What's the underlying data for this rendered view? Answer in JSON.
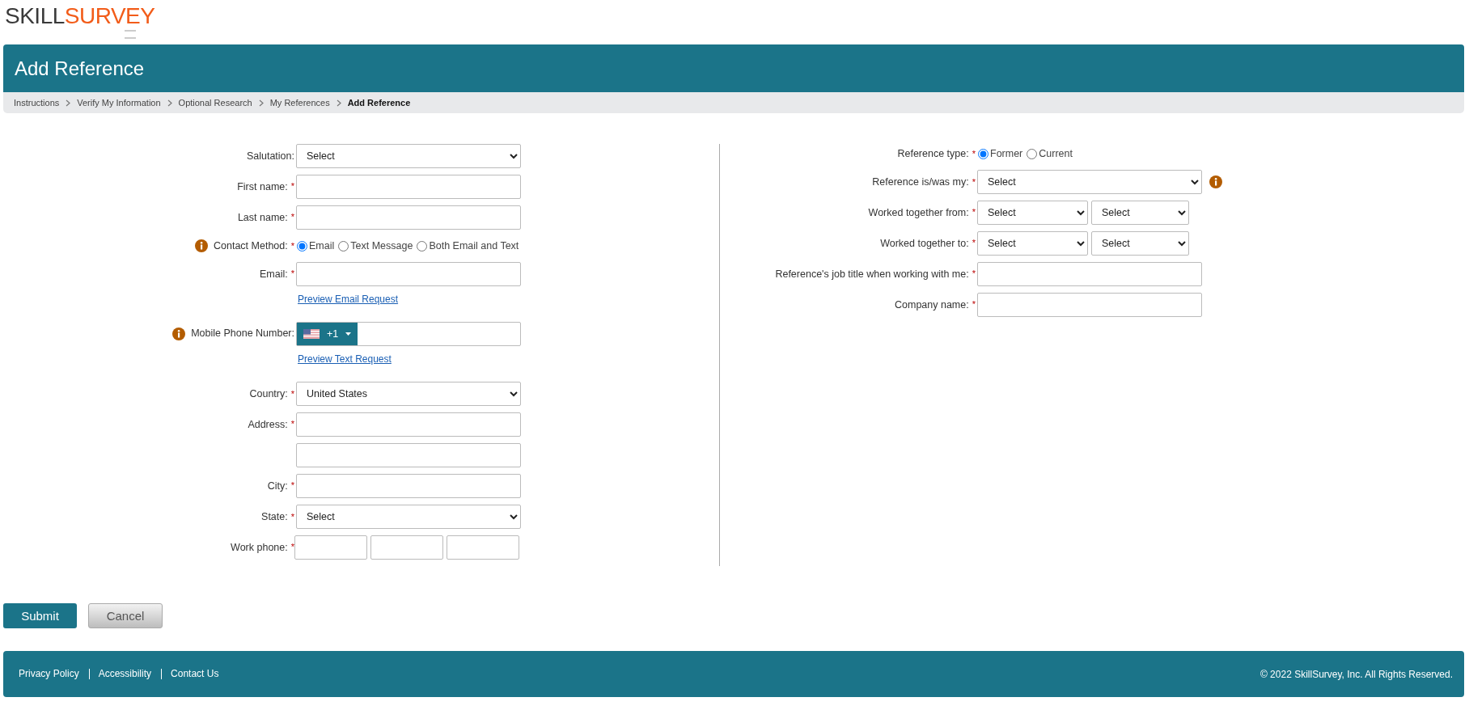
{
  "logo": {
    "first": "SKILL",
    "second": "SURVEY"
  },
  "header": {
    "title": "Add Reference"
  },
  "breadcrumb": [
    {
      "label": "Instructions",
      "current": false
    },
    {
      "label": "Verify My Information",
      "current": false
    },
    {
      "label": "Optional Research",
      "current": false
    },
    {
      "label": "My References",
      "current": false
    },
    {
      "label": "Add Reference",
      "current": true
    }
  ],
  "form": {
    "columns": [
      {
        "fields": [
          {
            "kind": "select",
            "label": "Salutation:",
            "value": "Select",
            "info": false
          },
          {
            "kind": "text",
            "label": "First name:",
            "required": "*",
            "info": false
          },
          {
            "kind": "text",
            "label": "Last name:",
            "required": "*",
            "info": false
          },
          {
            "kind": "radio",
            "label": "Contact Method:",
            "required": "*",
            "info": true,
            "options": [
              {
                "label": "Email",
                "selected": true
              },
              {
                "label": "Text Message",
                "selected": false
              },
              {
                "label": "Both Email and Text",
                "selected": false
              }
            ]
          },
          {
            "kind": "text",
            "label": "Email:",
            "required": "*",
            "info": false
          },
          {
            "kind": "link",
            "text": "Preview Email Request",
            "info": false
          },
          {
            "kind": "phone",
            "label": "Mobile Phone Number:",
            "code": "+1",
            "info": true
          },
          {
            "kind": "link",
            "text": "Preview Text Request",
            "info": false
          },
          {
            "kind": "select",
            "label": "Country:",
            "required": "*",
            "value": "United States",
            "info": false
          },
          {
            "kind": "text",
            "label": "Address:",
            "required": "*",
            "info": false
          },
          {
            "kind": "text",
            "info": false
          },
          {
            "kind": "text",
            "label": "City:",
            "required": "*",
            "info": false
          },
          {
            "kind": "select",
            "label": "State:",
            "required": "*",
            "value": "Select",
            "info": false
          },
          {
            "kind": "phone_parts",
            "label": "Work phone:",
            "required": "*",
            "info": false
          }
        ]
      },
      {
        "fields": [
          {
            "kind": "radio",
            "label": "Reference type:",
            "required": "*",
            "info": false,
            "options": [
              {
                "label": "Former",
                "selected": true
              },
              {
                "label": "Current",
                "selected": false
              }
            ]
          },
          {
            "kind": "select",
            "label": "Reference is/was my:",
            "required": "*",
            "value": "Select",
            "info": true
          },
          {
            "kind": "select_pair",
            "label": "Worked together from:",
            "required": "*",
            "values": [
              "Select",
              "Select"
            ],
            "info": false
          },
          {
            "kind": "select_pair",
            "label": "Worked together to:",
            "required": "*",
            "values": [
              "Select",
              "Select"
            ],
            "info": false
          },
          {
            "kind": "text",
            "label": "Reference's job title when working with me:",
            "required": "*",
            "info": false
          },
          {
            "kind": "text",
            "label": "Company name:",
            "required": "*",
            "info": false
          }
        ]
      }
    ]
  },
  "buttons": {
    "submit": "Submit",
    "cancel": "Cancel"
  },
  "footer": {
    "links": [
      "Privacy Policy",
      "Accessibility",
      "Contact Us"
    ],
    "copyright": "© 2022 SkillSurvey, Inc. All Rights Reserved."
  }
}
